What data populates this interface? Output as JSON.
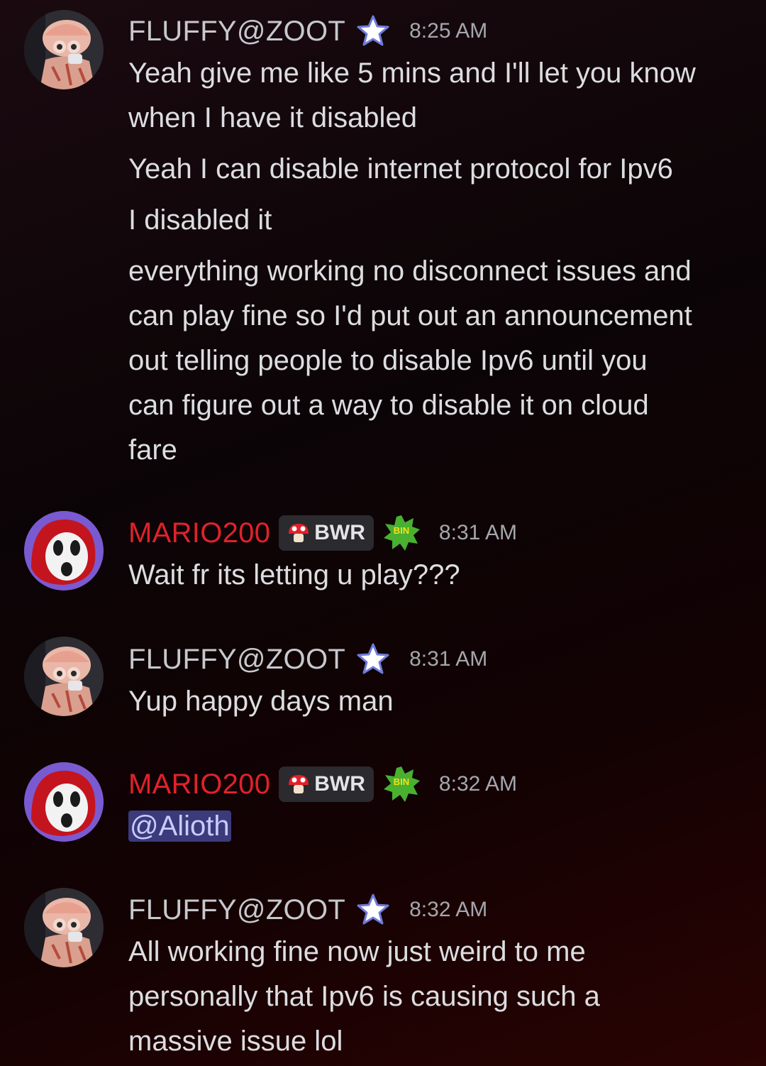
{
  "messages": [
    {
      "author": "FLUFFY@ZOOT",
      "author_color": "#c6c8cc",
      "time": "8:25 AM",
      "lines": [
        [
          "Yeah give me like 5 mins and I'll let you know",
          "when I have it disabled"
        ],
        [
          "Yeah I can disable internet protocol for Ipv6"
        ],
        [
          "I disabled it"
        ],
        [
          "everything working no disconnect issues and",
          "can play fine so I'd put out an announcement",
          "out telling people to disable Ipv6 until you",
          "can figure out a way to disable it on cloud",
          "fare"
        ]
      ]
    },
    {
      "author": "MARIO200",
      "author_color": "#e0222a",
      "tag": "BWR",
      "time": "8:31 AM",
      "lines": [
        [
          "Wait fr its letting u play???"
        ]
      ]
    },
    {
      "author": "FLUFFY@ZOOT",
      "author_color": "#c6c8cc",
      "time": "8:31 AM",
      "lines": [
        [
          "Yup happy days man"
        ]
      ]
    },
    {
      "author": "MARIO200",
      "author_color": "#e0222a",
      "tag": "BWR",
      "time": "8:32 AM",
      "mention": "@Alioth"
    },
    {
      "author": "FLUFFY@ZOOT",
      "author_color": "#c6c8cc",
      "time": "8:32 AM",
      "lines": [
        [
          "All working fine now just weird to me",
          "personally that Ipv6 is causing such a",
          "massive issue lol"
        ]
      ]
    }
  ],
  "icons": {
    "fluffy_avatar": "user-avatar-hat",
    "mario_avatar": "user-avatar-shyguy",
    "star": "star-badge-icon",
    "mushroom": "mushroom-icon",
    "bin": "bin-badge-icon"
  }
}
